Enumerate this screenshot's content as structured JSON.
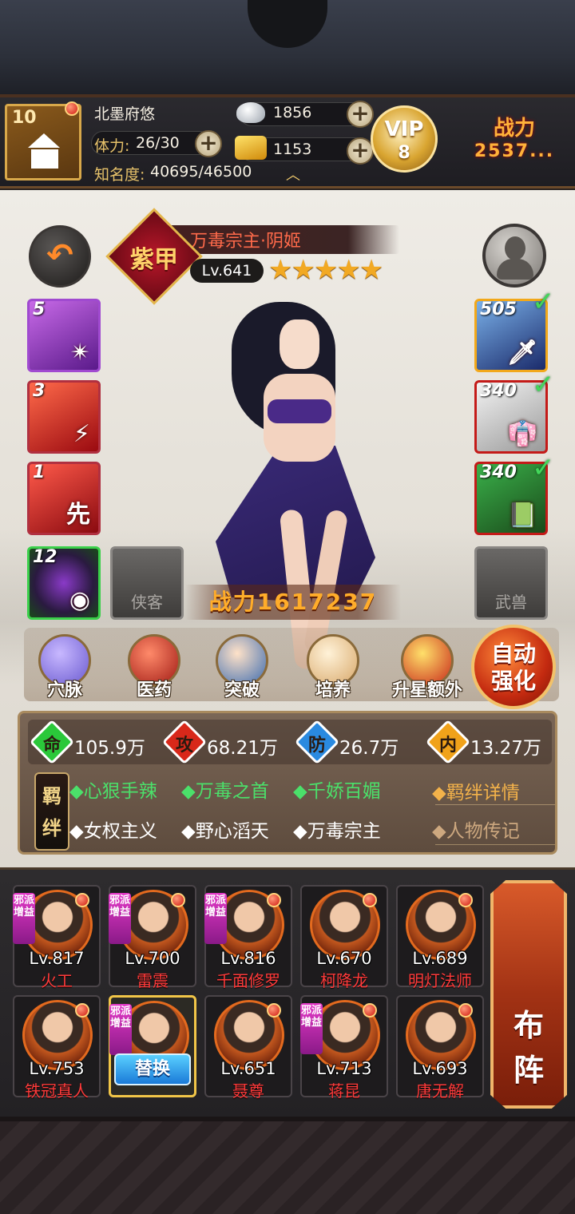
{
  "player": {
    "level": "10",
    "name": "北墨府悠",
    "stamina_label": "体力:",
    "stamina_value": "26/30",
    "fame_label": "知名度:",
    "fame_value": "40695/46500",
    "silver": "1856",
    "gold": "1153",
    "vip_label": "VIP",
    "vip_level": "8",
    "power_label": "战力",
    "power_value": "2537..."
  },
  "hero": {
    "title": "万毒宗主·阴姬",
    "rank": "紫甲",
    "level": "Lv.641",
    "stars": 5,
    "stars_text": "★★★★★",
    "power": "战力1617237"
  },
  "skills": [
    {
      "num": "5",
      "glyph": "",
      "color": "#7a2ab0"
    },
    {
      "num": "3",
      "glyph": "",
      "color": "#c41a18"
    },
    {
      "num": "1",
      "glyph": "先",
      "color": "#c41a18"
    },
    {
      "num": "12",
      "glyph": "",
      "color": "#2a7a2a"
    }
  ],
  "equipment": [
    {
      "num": "505"
    },
    {
      "num": "340"
    },
    {
      "num": "340"
    }
  ],
  "slots": {
    "companion": "侠客",
    "beast": "武兽"
  },
  "menu": [
    {
      "label": "穴脉",
      "icon": "meridian-icon"
    },
    {
      "label": "医药",
      "icon": "medicine-icon"
    },
    {
      "label": "突破",
      "icon": "breakthrough-icon"
    },
    {
      "label": "培养",
      "icon": "cultivate-icon"
    },
    {
      "label": "升星额外",
      "icon": "star-up-icon"
    }
  ],
  "auto_button": "自动强化",
  "stats": [
    {
      "glyph": "命",
      "value": "105.9万",
      "color": "#2ac83a"
    },
    {
      "glyph": "攻",
      "value": "68.21万",
      "color": "#d8281a"
    },
    {
      "glyph": "防",
      "value": "26.7万",
      "color": "#2a8ae0"
    },
    {
      "glyph": "内",
      "value": "13.27万",
      "color": "#f0a21a"
    }
  ],
  "bonds": {
    "badge": "羁绊",
    "active": [
      "◆心狠手辣",
      "◆万毒之首",
      "◆千娇百媚"
    ],
    "inactive": [
      "◆女权主义",
      "◆野心滔天",
      "◆万毒宗主"
    ],
    "details_link": "◆羁绊详情",
    "biography_link": "◆人物传记"
  },
  "team": [
    {
      "level": "Lv.817",
      "name": "火工",
      "tag": true
    },
    {
      "level": "Lv.700",
      "name": "雷震",
      "tag": true
    },
    {
      "level": "Lv.816",
      "name": "千面修罗",
      "tag": true
    },
    {
      "level": "Lv.670",
      "name": "柯降龙",
      "tag": false
    },
    {
      "level": "Lv.689",
      "name": "明灯法师",
      "tag": false
    },
    {
      "level": "Lv.753",
      "name": "铁冠真人",
      "tag": false
    },
    {
      "level": "",
      "name": "",
      "tag": true,
      "selected": true
    },
    {
      "level": "Lv.651",
      "name": "聂尊",
      "tag": false
    },
    {
      "level": "Lv.713",
      "name": "蒋昆",
      "tag": true
    },
    {
      "level": "Lv.693",
      "name": "唐无解",
      "tag": false
    }
  ],
  "faction_tag": "邪派增益",
  "replace_button": "替换",
  "formation_button": "布阵"
}
